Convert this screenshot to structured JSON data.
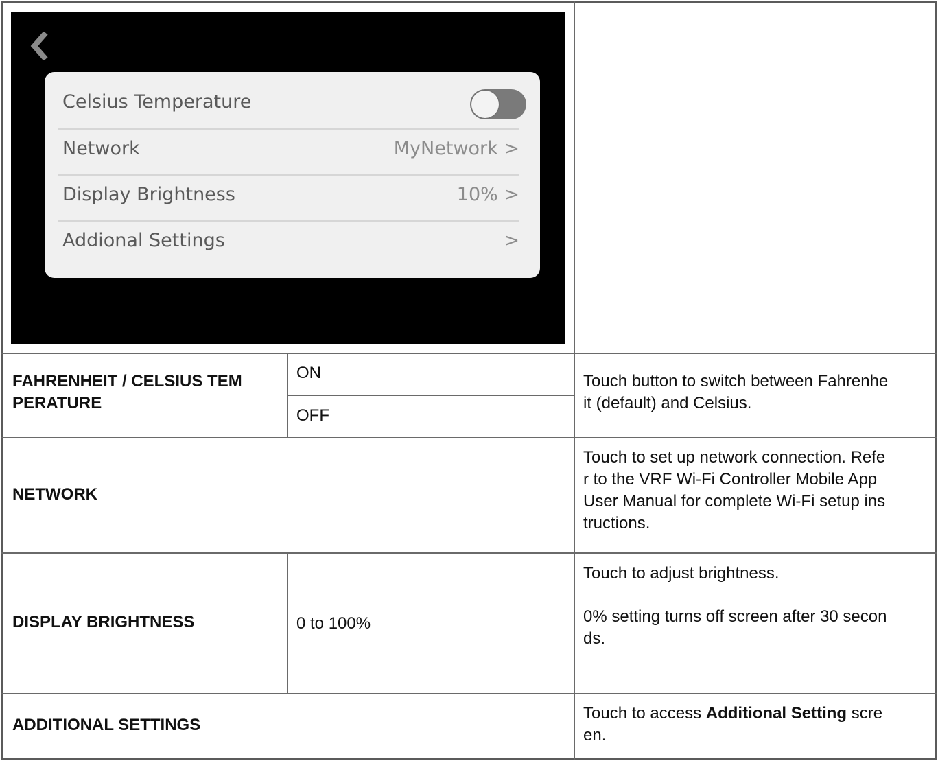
{
  "screen": {
    "back_icon": "chevron-left-icon",
    "rows": [
      {
        "label": "Celsius Temperature",
        "value": "",
        "control": "toggle",
        "toggle_on": false
      },
      {
        "label": "Network",
        "value": "MyNetwork >"
      },
      {
        "label": "Display Brightness",
        "value": "10% >"
      },
      {
        "label": "Addional Settings",
        "value": ">"
      }
    ]
  },
  "table": {
    "rows": [
      {
        "setting": "FAHRENHEIT / CELSIUS TEM\nPERATURE",
        "options": [
          "ON",
          "OFF"
        ],
        "description": "Touch button to switch between Fahrenhe\nit (default) and Celsius."
      },
      {
        "setting": "NETWORK",
        "description": "Touch to set up network connection. Refe\nr to the VRF Wi-Fi Controller Mobile App\nUser Manual for complete Wi-Fi setup ins\ntructions."
      },
      {
        "setting": "DISPLAY BRIGHTNESS",
        "option": "0 to 100%",
        "description_1": "Touch to adjust brightness.",
        "description_2": "0% setting turns off screen after 30 secon\nds."
      },
      {
        "setting": "ADDITIONAL SETTINGS",
        "description_prefix": "Touch to access ",
        "description_bold": "Additional Setting",
        "description_suffix": " scre\nen."
      }
    ]
  },
  "colors": {
    "screen_bg": "#000000",
    "card_bg": "#f0f0f0",
    "toggle_off": "#7a7a7a"
  }
}
